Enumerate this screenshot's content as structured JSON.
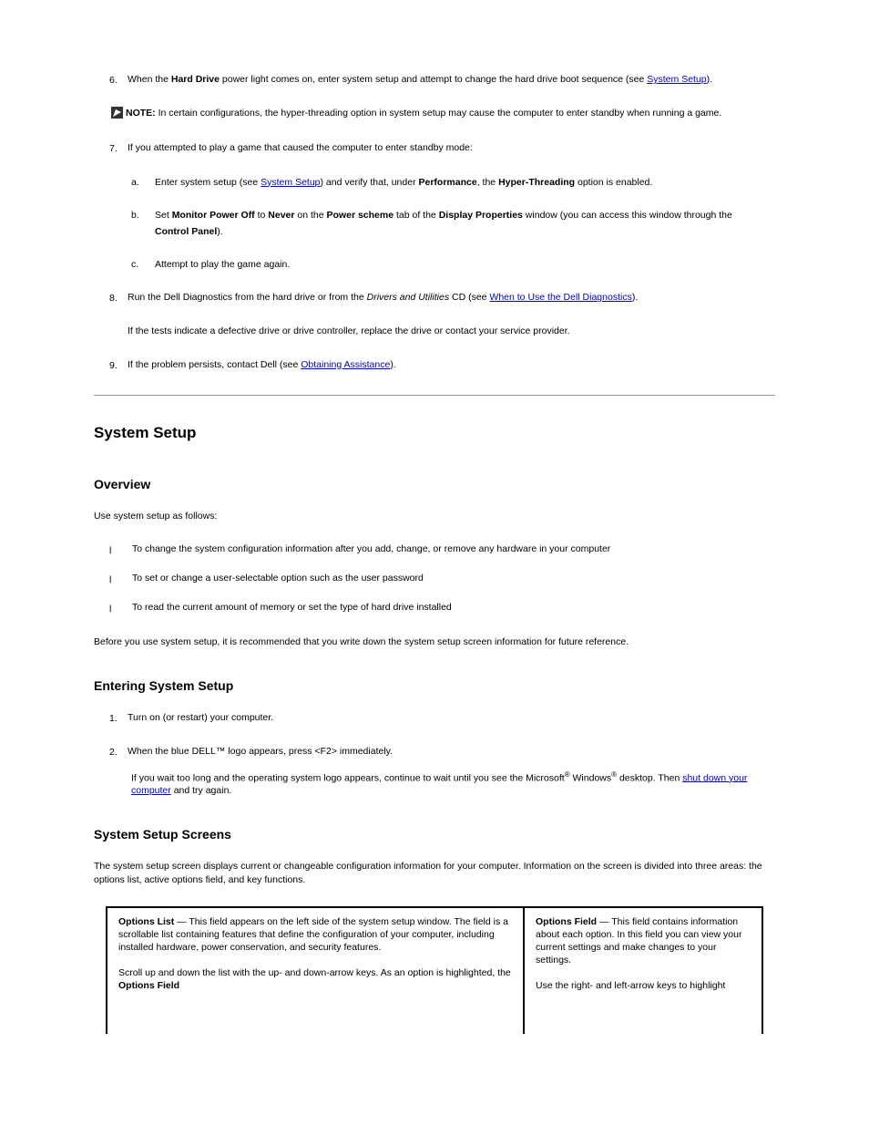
{
  "item6": {
    "num": "6.",
    "text_a": "When the ",
    "bold_a": "Hard Drive",
    "text_b": " power light comes on, enter system setup and attempt to change the hard drive boot sequence (see ",
    "link_a": "System Setup",
    "text_c": ")."
  },
  "note": {
    "label": "NOTE:",
    "text": " In certain configurations, the hyper-threading option in system setup may cause the computer to enter standby when running a game."
  },
  "item7": {
    "num": "7.",
    "text": "If you attempted to play a game that caused the computer to enter standby mode:"
  },
  "item7a": {
    "letter": "a.",
    "text_a": "Enter system setup (see ",
    "link_a": "System Setup",
    "text_b": ") and verify that, under ",
    "bold_a": "Performance",
    "text_c": ", the ",
    "bold_b": "Hyper-Threading",
    "text_d": " option is enabled."
  },
  "item7b": {
    "letter": "b.",
    "text_a": "Set ",
    "bold_a": "Monitor Power Off",
    "text_b": " to ",
    "bold_b": "Never",
    "text_c": " on the ",
    "bold_c": "Power scheme",
    "text_d": " tab of the ",
    "bold_d": "Display Properties",
    "text_e": " window (you can access this window through the "
  },
  "item7b_cont": {
    "bold_a": "Control Panel",
    "text_a": ")."
  },
  "item7c": {
    "letter": "c.",
    "text": "Attempt to play the game again."
  },
  "item8": {
    "num": "8.",
    "text_a": "Run the Dell Diagnostics from the hard drive or from the ",
    "italic_a": "Drivers and Utilities",
    "text_b": " CD (see ",
    "link_a": "When to Use the Dell Diagnostics",
    "text_c": ")."
  },
  "conclude8": {
    "text": "If the tests indicate a defective drive or drive controller, replace the drive or contact your service provider."
  },
  "item9": {
    "num": "9.",
    "text_a": "If the problem persists, contact Dell (see ",
    "link_a": "Obtaining Assistance",
    "text_b": ")."
  },
  "section_title": "System Setup",
  "overview_title": "Overview",
  "overview_text": "Use system setup as follows:",
  "bullet1": "To change the system configuration information after you add, change, or remove any hardware in your computer",
  "bullet2": "To set or change a user-selectable option such as the user password",
  "bullet3": "To read the current amount of memory or set the type of hard drive installed",
  "overview_note": "Before you use system setup, it is recommended that you write down the system setup screen information for future reference.",
  "entering_title": "Entering System Setup",
  "enter1": {
    "num": "1.",
    "text": "Turn on (or restart) your computer."
  },
  "enter2": {
    "num": "2.",
    "text": "When the blue DELL™ logo appears, press <F2> immediately.",
    "sub_text_a": "If you wait too long and the operating system logo appears, continue to wait until you see the Microsoft",
    "reg1": "®",
    "sub_text_b": " Windows",
    "reg2": "®",
    "sub_text_c": " desktop. Then ",
    "link_a": "shut down your computer",
    "sub_text_d": " and try again."
  },
  "screens_title": "System Setup Screens",
  "screens_text": "The system setup screen displays current or changeable configuration information for your computer. Information on the screen is divided into three areas: the options list, active options field, and key functions.",
  "table_left": {
    "heading_a": "Options List",
    "heading_b": " — This field appears on the left side of the system setup window. The field is a scrollable list containing features that define the configuration of your computer, including installed hardware, power conservation, and security features.",
    "para2_a": "Scroll up and down the list with the up- and down-arrow keys. As an option is highlighted, the ",
    "para2_bold": "Options Field"
  },
  "table_right": {
    "heading_a": "Options Field",
    "heading_b": " — This field contains information about each option. In this field you can view your current settings and make changes to your settings.",
    "para2_a": "Use the right- and left-arrow keys to highlight"
  }
}
